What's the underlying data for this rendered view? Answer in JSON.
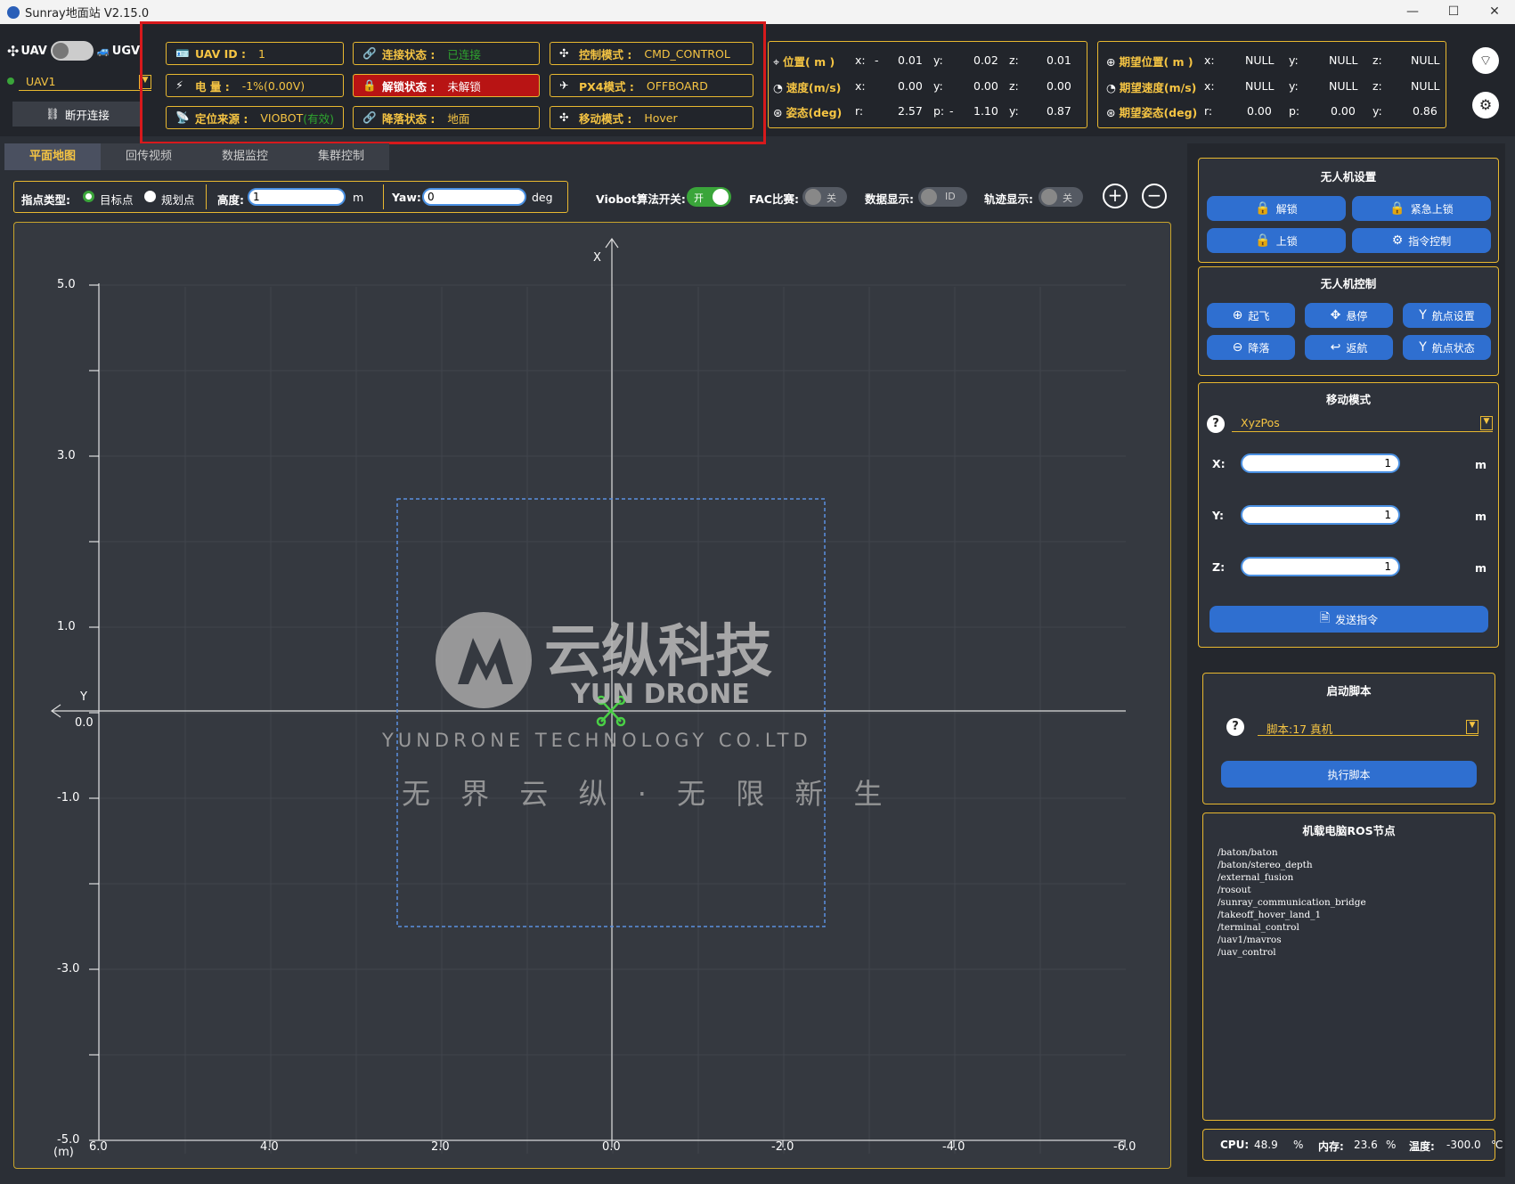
{
  "window": {
    "title": "Sunray地面站 V2.15.0",
    "min": "—",
    "max": "☐",
    "close": "✕"
  },
  "vehicle": {
    "uav_label": "UAV",
    "ugv_label": "UGV",
    "selected": "UAV1",
    "disconnect": "断开连接"
  },
  "status": {
    "uav_id_k": "UAV ID :",
    "uav_id_v": "1",
    "battery_k": "电       量 :",
    "battery_v": "-1%(0.00V)",
    "loc_k": "定位来源 :",
    "loc_v": "VIOBOT",
    "loc_valid": "(有效)",
    "conn_k": "连接状态 :",
    "conn_v": "已连接",
    "lock_k": "解锁状态 :",
    "lock_v": "未解锁",
    "land_k": "降落状态 :",
    "land_v": "地面",
    "ctrl_k": "控制模式 :",
    "ctrl_v": "CMD_CONTROL",
    "px4_k": "PX4模式 :",
    "px4_v": "OFFBOARD",
    "move_k": "移动模式 :",
    "move_v": "Hover"
  },
  "telemetry": {
    "pos_label": "位置( m )",
    "vel_label": "速度(m/s)",
    "att_label": "姿态(deg)",
    "pos": {
      "x": "0.01",
      "y": "0.02",
      "z": "0.01",
      "xsign": "-"
    },
    "vel": {
      "x": "0.00",
      "y": "0.00",
      "z": "0.00"
    },
    "att": {
      "r": "2.57",
      "p": "1.10",
      "y": "0.87",
      "psign": "-"
    },
    "x": "x:",
    "y": "y:",
    "z": "z:",
    "r": "r:",
    "p": "p:",
    "ya": "y:"
  },
  "desired": {
    "pos_label": "期望位置( m )",
    "vel_label": "期望速度(m/s)",
    "att_label": "期望姿态(deg)",
    "pos": {
      "x": "NULL",
      "y": "NULL",
      "z": "NULL"
    },
    "vel": {
      "x": "NULL",
      "y": "NULL",
      "z": "NULL"
    },
    "att": {
      "r": "0.00",
      "p": "0.00",
      "y": "0.86"
    }
  },
  "tabs": [
    "平面地图",
    "回传视频",
    "数据监控",
    "集群控制"
  ],
  "toolbar": {
    "point_type": "指点类型:",
    "target": "目标点",
    "plan": "规划点",
    "height": "高度:",
    "height_value": "1",
    "m": "m",
    "yaw": "Yaw:",
    "yaw_value": "0",
    "deg": "deg",
    "viobot": "Viobot算法开关:",
    "viobot_state": "开",
    "fac": "FAC比赛:",
    "fac_state": "关",
    "data": "数据显示:",
    "data_state": "ID",
    "track": "轨迹显示:",
    "track_state": "关",
    "zoom_in": "+",
    "zoom_out": "−"
  },
  "map": {
    "x_axis": "X",
    "y_axis": "Y",
    "unit": "(m)",
    "y_ticks": [
      "5.0",
      "3.0",
      "1.0",
      "0.0",
      "-1.0",
      "-3.0",
      "-5.0"
    ],
    "x_ticks": [
      "6.0",
      "4.0",
      "2.0",
      "0.0",
      "-2.0",
      "-4.0",
      "-6.0"
    ],
    "brand_cn": "云纵科技",
    "brand_en": "YUN DRONE",
    "brand_full": "YUNDRONE TECHNOLOGY CO.LTD",
    "slogan": "无 界 云 纵 · 无 限 新 生"
  },
  "uav_settings": {
    "title": "无人机设置",
    "unlock": "解锁",
    "emergency": "紧急上锁",
    "lock": "上锁",
    "cmd": "指令控制"
  },
  "uav_control": {
    "title": "无人机控制",
    "takeoff": "起飞",
    "hover": "悬停",
    "waypoint_set": "航点设置",
    "land": "降落",
    "return": "返航",
    "waypoint_state": "航点状态"
  },
  "move_mode": {
    "title": "移动模式",
    "mode": "XyzPos",
    "x_label": "X:",
    "y_label": "Y:",
    "z_label": "Z:",
    "x": "1",
    "y": "1",
    "z": "1",
    "unit": "m",
    "send": "发送指令"
  },
  "script": {
    "title": "启动脚本",
    "selected": "脚本:17 真机",
    "run": "执行脚本"
  },
  "ros": {
    "title": "机载电脑ROS节点",
    "nodes": [
      "/baton/baton",
      "/baton/stereo_depth",
      "/external_fusion",
      "/rosout",
      "/sunray_communication_bridge",
      "/takeoff_hover_land_1",
      "/terminal_control",
      "/uav1/mavros",
      "/uav_control"
    ]
  },
  "system": {
    "cpu_label": "CPU:",
    "cpu": "48.9",
    "pct": "%",
    "mem_label": "内存:",
    "mem": "23.6",
    "temp_label": "温度:",
    "temp": "-300.0",
    "temp_unit": "℃"
  },
  "colors": {
    "accent": "#f5c443",
    "button": "#2f6fd0",
    "alarm": "#b81414",
    "ok": "#3aa53a"
  }
}
